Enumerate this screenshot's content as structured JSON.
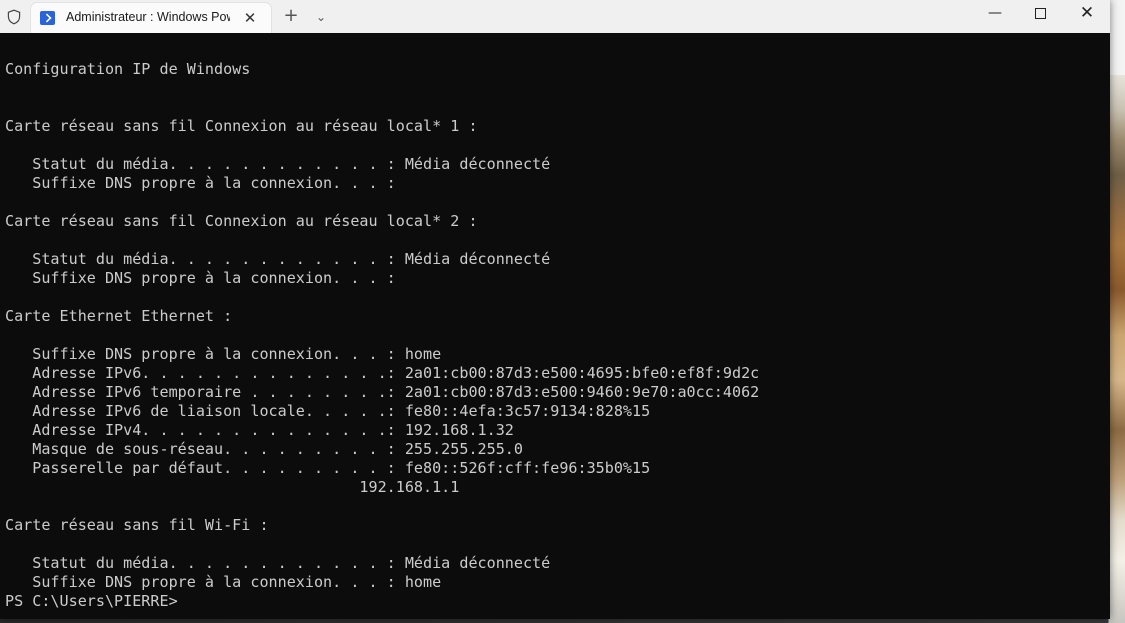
{
  "titlebar": {
    "tab_title": "Administrateur : Windows PowerShell",
    "tab_close_glyph": "✕",
    "new_tab_glyph": "+",
    "dropdown_glyph": "⌄",
    "minimize_glyph": "—",
    "close_glyph": "✕"
  },
  "terminal": {
    "lines": [
      "Configuration IP de Windows",
      "Carte réseau sans fil Connexion au réseau local* 1 :",
      "   Statut du média. . . . . . . . . . . . : Média déconnecté",
      "   Suffixe DNS propre à la connexion. . . :",
      "Carte réseau sans fil Connexion au réseau local* 2 :",
      "   Statut du média. . . . . . . . . . . . : Média déconnecté",
      "   Suffixe DNS propre à la connexion. . . :",
      "Carte Ethernet Ethernet :",
      "   Suffixe DNS propre à la connexion. . . : home",
      "   Adresse IPv6. . . . . . . . . . . . . .: 2a01:cb00:87d3:e500:4695:bfe0:ef8f:9d2c",
      "   Adresse IPv6 temporaire . . . . . . . .: 2a01:cb00:87d3:e500:9460:9e70:a0cc:4062",
      "   Adresse IPv6 de liaison locale. . . . .: fe80::4efa:3c57:9134:828%15",
      "   Adresse IPv4. . . . . . . . . . . . . .: 192.168.1.32",
      "   Masque de sous-réseau. . . . . . . . . : 255.255.255.0",
      "   Passerelle par défaut. . . . . . . . . : fe80::526f:cff:fe96:35b0%15",
      "                                       192.168.1.1",
      "Carte réseau sans fil Wi-Fi :",
      "   Statut du média. . . . . . . . . . . . : Média déconnecté",
      "   Suffixe DNS propre à la connexion. . . : home",
      "PS C:\\Users\\PIERRE>"
    ]
  },
  "colors": {
    "terminal_bg": "#0c0c0c",
    "terminal_text": "#cccccc",
    "titlebar_bg": "#f0f0f0",
    "tab_bg": "#fbfbfb",
    "powershell_icon": "#2b63d8"
  }
}
